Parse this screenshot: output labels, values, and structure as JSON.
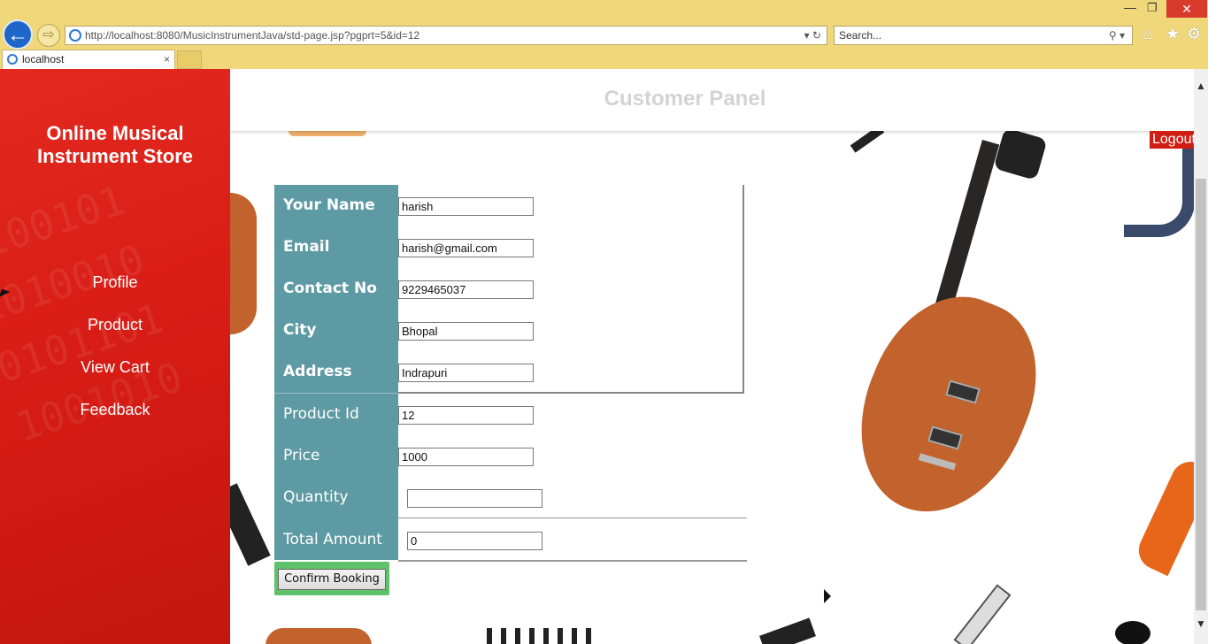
{
  "browser": {
    "url": "http://localhost:8080/MusicInstrumentJava/std-page.jsp?pgprt=5&id=12",
    "search_placeholder": "Search...",
    "tab_title": "localhost"
  },
  "sidebar": {
    "brand_line1": "Online Musical",
    "brand_line2": "Instrument Store",
    "items": [
      {
        "label": "Profile"
      },
      {
        "label": "Product"
      },
      {
        "label": "View Cart"
      },
      {
        "label": "Feedback"
      }
    ]
  },
  "header": {
    "title": "Customer Panel",
    "logout": "Logout"
  },
  "form": {
    "name_label": "Your Name",
    "name_value": "harish",
    "email_label": "Email",
    "email_value": "harish@gmail.com",
    "contact_label": "Contact No",
    "contact_value": "9229465037",
    "city_label": "City",
    "city_value": "Bhopal",
    "address_label": "Address",
    "address_value": "Indrapuri",
    "product_id_label": "Product Id",
    "product_id_value": "12",
    "price_label": "Price",
    "price_value": "1000",
    "quantity_label": "Quantity",
    "quantity_value": "",
    "total_label": "Total Amount",
    "total_value": "0",
    "confirm_label": "Confirm Booking"
  }
}
